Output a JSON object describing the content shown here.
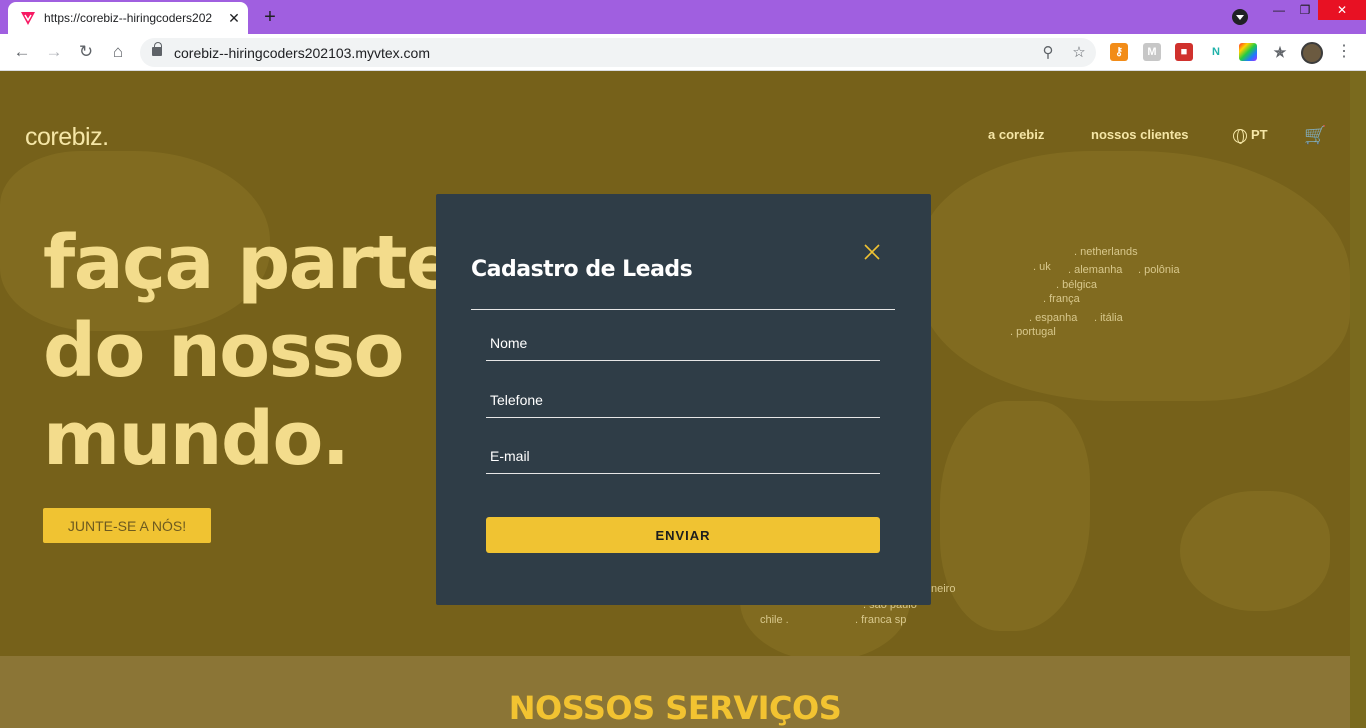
{
  "browser": {
    "tab_title": "https://corebiz--hiringcoders202",
    "url": "corebiz--hiringcoders202103.myvtex.com",
    "close_glyph": "✕",
    "new_tab_glyph": "+",
    "window": {
      "minimize": "—",
      "maximize": "❐",
      "close": "✕"
    }
  },
  "site": {
    "logo": "corebiz.",
    "nav": {
      "about": "a corebiz",
      "clients": "nossos clientes",
      "language": "PT"
    },
    "hero": {
      "line1": "faça parte",
      "line2": "do nosso",
      "line3": "mundo.",
      "cta": "JUNTE-SE A NÓS!"
    },
    "map_cities": {
      "netherlands": ". netherlands",
      "uk": ". uk",
      "alemanha": ". alemanha",
      "polonia": ". polônia",
      "belgica": ". bélgica",
      "franca": ". frança",
      "espanha": ". espanha",
      "italia": ". itália",
      "portugal": ". portugal",
      "rio_partial": "neiro",
      "sao_paulo": ". são paulo",
      "chile": "chile .",
      "franca_sp": ". franca sp"
    },
    "services_title": "NOSSOS SERVIÇOS"
  },
  "modal": {
    "title": "Cadastro de Leads",
    "fields": {
      "name_placeholder": "Nome",
      "phone_placeholder": "Telefone",
      "email_placeholder": "E-mail"
    },
    "submit": "ENVIAR"
  },
  "colors": {
    "accent_yellow": "#f0c332",
    "modal_bg": "#2f3d47",
    "hero_overlay": "#76611a",
    "browser_frame": "#a05fe0"
  }
}
